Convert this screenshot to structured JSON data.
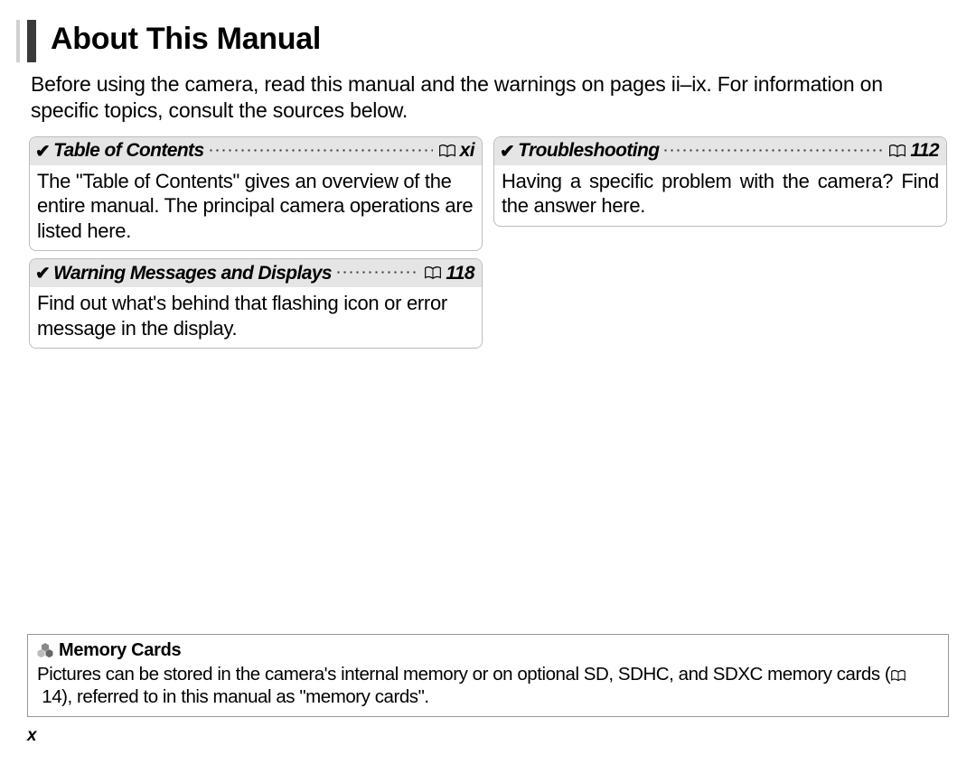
{
  "title": "About This Manual",
  "intro": "Before using the camera, read this manual and the warnings on pages ii–ix.  For information on specific topics, consult the sources below.",
  "cards": {
    "toc": {
      "title": "Table of Contents",
      "page": "xi",
      "body": "The \"Table of Contents\" gives an overview of the entire manual.  The principal camera operations are listed here."
    },
    "warn": {
      "title": "Warning Messages and Displays",
      "page": "118",
      "body": "Find out what's behind that flashing icon or error message in the display."
    },
    "troub": {
      "title": "Troubleshooting",
      "page": "112",
      "body": "Having a specific problem with the camera? Find the answer here."
    }
  },
  "note": {
    "title": "Memory Cards",
    "body_pre": "Pictures can be stored in the camera's internal memory or on optional SD, SDHC, and SDXC memory cards (",
    "body_page": "14",
    "body_post": "), referred to in this manual as \"memory cards\"."
  },
  "page_number": "x"
}
